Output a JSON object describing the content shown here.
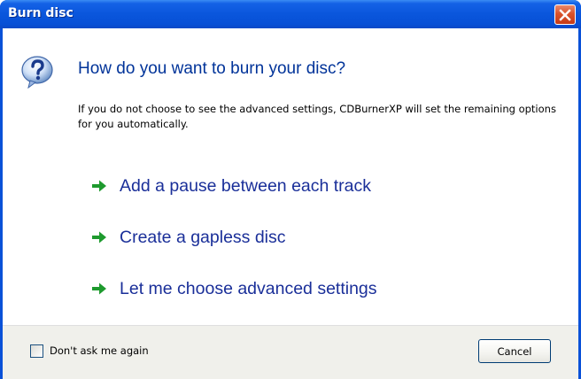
{
  "window": {
    "title": "Burn disc"
  },
  "dialog": {
    "heading": "How do you want to burn your disc?",
    "description": "If you do not choose to see the advanced settings, CDBurnerXP will set the remaining options for you automatically.",
    "options": [
      {
        "label": "Add a pause between each track",
        "icon": "green-arrow-icon"
      },
      {
        "label": "Create a gapless disc",
        "icon": "green-arrow-icon"
      },
      {
        "label": "Let me choose advanced settings",
        "icon": "green-arrow-icon"
      }
    ]
  },
  "footer": {
    "checkbox_label": "Don't ask me again",
    "checkbox_checked": false,
    "cancel_label": "Cancel"
  },
  "colors": {
    "titlebar": "#0a56dc",
    "heading": "#003399",
    "option_text": "#1a2f99",
    "arrow": "#1e9a2e",
    "close_button": "#d9522b"
  }
}
